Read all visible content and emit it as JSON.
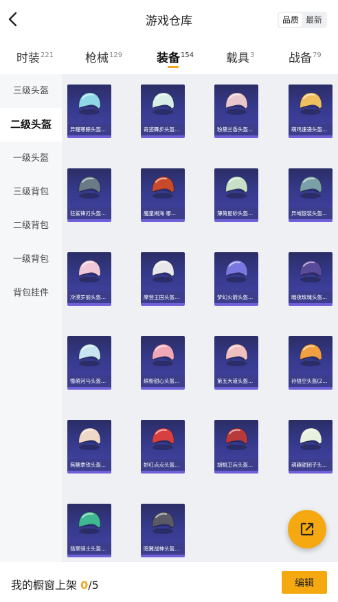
{
  "header": {
    "title": "游戏仓库",
    "sort_quality": "品质",
    "sort_newest": "最新"
  },
  "tabs": [
    {
      "label": "时装",
      "count": "221"
    },
    {
      "label": "枪械",
      "count": "129"
    },
    {
      "label": "装备",
      "count": "154"
    },
    {
      "label": "载具",
      "count": "3"
    },
    {
      "label": "战备",
      "count": "79"
    }
  ],
  "sidebar": [
    "三级头盔",
    "二级头盔",
    "一级头盔",
    "三级背包",
    "二级背包",
    "一级背包",
    "背包挂件"
  ],
  "items": [
    {
      "name": "异瞳寒鲸头盔...",
      "color": "#8ed8e8"
    },
    {
      "name": "奇迹舞步头盔...",
      "color": "#d8efe8"
    },
    {
      "name": "粉黛兰香头盔...",
      "color": "#e8c8cc"
    },
    {
      "name": "萌鸡速递头盔...",
      "color": "#f0c060"
    },
    {
      "name": "狂鲨锋刃头盔...",
      "color": "#6a7a86"
    },
    {
      "name": "魔童闹海 哪...",
      "color": "#c84a2a"
    },
    {
      "name": "薄荷星砂头盔...",
      "color": "#c8e0c8"
    },
    {
      "name": "异域银装头盔...",
      "color": "#7aa0a8"
    },
    {
      "name": "冷漠罗丽头盔...",
      "color": "#f0c8d8"
    },
    {
      "name": "摩登王国头盔...",
      "color": "#e8e8ea"
    },
    {
      "name": "梦幻火箭头盔...",
      "color": "#7a78e0"
    },
    {
      "name": "暗夜玫瑰头盔...",
      "color": "#5a4a9a"
    },
    {
      "name": "憧萌河马头盔...",
      "color": "#c8e4f0"
    },
    {
      "name": "缤粉甜心头盔...",
      "color": "#f0a8b8"
    },
    {
      "name": "第五大道头盔...",
      "color": "#f0c0c0"
    },
    {
      "name": "孙悟空头盔(2...",
      "color": "#f0a040"
    },
    {
      "name": "焦糖拿铁头盔...",
      "color": "#f0d8c8"
    },
    {
      "name": "妙红点点头盔...",
      "color": "#d84040"
    },
    {
      "name": "胡桃卫兵头盔...",
      "color": "#b83a3a"
    },
    {
      "name": "萌趣甜团子头...",
      "color": "#e8f0e0"
    },
    {
      "name": "翡翠骑士头盔...",
      "color": "#40b890"
    },
    {
      "name": "暗翼战神头盔...",
      "color": "#5a5a66"
    }
  ],
  "footer": {
    "prefix": "我的橱窗上架 ",
    "current": "0",
    "total": "/5",
    "edit_label": "编辑"
  },
  "colors": {
    "accent": "#f5a623",
    "card_bg": "#35398a",
    "card_bar": "#6f5fd8"
  }
}
